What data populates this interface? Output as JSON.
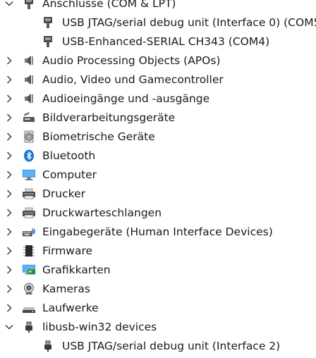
{
  "tree": [
    {
      "label": "Anschlüsse (COM & LPT)",
      "expanded": true,
      "icon": "ports-icon"
    },
    {
      "label": "USB JTAG/serial debug unit (Interface 0) (COM5",
      "child": true,
      "icon": "usb-serial-icon"
    },
    {
      "label": "USB-Enhanced-SERIAL CH343 (COM4)",
      "child": true,
      "icon": "usb-serial-icon"
    },
    {
      "label": "Audio Processing Objects (APOs)",
      "expanded": false,
      "icon": "speaker-icon"
    },
    {
      "label": "Audio, Video und Gamecontroller",
      "expanded": false,
      "icon": "speaker-icon"
    },
    {
      "label": "Audioeingänge und -ausgänge",
      "expanded": false,
      "icon": "speaker-icon"
    },
    {
      "label": "Bildverarbeitungsgeräte",
      "expanded": false,
      "icon": "scanner-icon"
    },
    {
      "label": "Biometrische Geräte",
      "expanded": false,
      "icon": "fingerprint-icon"
    },
    {
      "label": "Bluetooth",
      "expanded": false,
      "icon": "bluetooth-icon"
    },
    {
      "label": "Computer",
      "expanded": false,
      "icon": "monitor-icon"
    },
    {
      "label": "Drucker",
      "expanded": false,
      "icon": "printer-icon"
    },
    {
      "label": "Druckwarteschlangen",
      "expanded": false,
      "icon": "printer-icon"
    },
    {
      "label": "Eingabegeräte (Human Interface Devices)",
      "expanded": false,
      "icon": "keyboard-mouse-icon"
    },
    {
      "label": "Firmware",
      "expanded": false,
      "icon": "chip-icon"
    },
    {
      "label": "Grafikkarten",
      "expanded": false,
      "icon": "display-adapter-icon"
    },
    {
      "label": "Kameras",
      "expanded": false,
      "icon": "webcam-icon"
    },
    {
      "label": "Laufwerke",
      "expanded": false,
      "icon": "drive-icon"
    },
    {
      "label": "libusb-win32 devices",
      "expanded": true,
      "icon": "usb-plug-icon"
    },
    {
      "label": "USB JTAG/serial debug unit (Interface 2)",
      "child": true,
      "icon": "usb-plug-icon"
    }
  ]
}
